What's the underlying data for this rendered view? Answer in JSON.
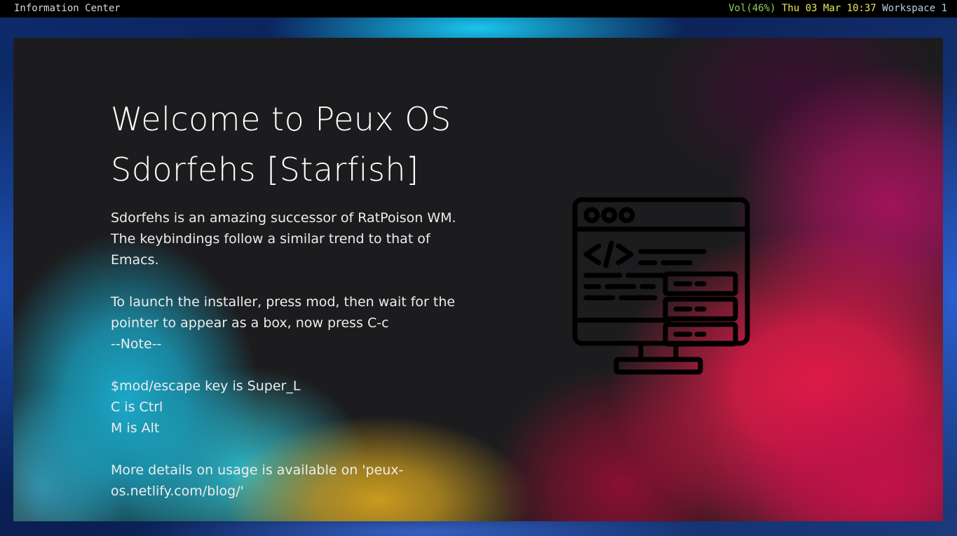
{
  "statusbar": {
    "window_title": "Information Center",
    "volume": "Vol(46%)",
    "clock": "Thu 03 Mar 10:37",
    "workspace": "Workspace 1"
  },
  "window": {
    "title_line1": "Welcome to Peux OS",
    "title_line2": "Sdorfehs [Starfish]",
    "paragraphs": [
      "Sdorfehs is an amazing successor of RatPoison WM. The keybindings follow a similar trend to that of Emacs.",
      "To launch the installer, press mod, then wait for the pointer to appear as a box, now press C-c",
      "--Note--",
      "$mod/escape key is Super_L",
      "C is Ctrl",
      "M is Alt",
      "More details on usage is available on 'peux-os.netlify.com/blog/'"
    ],
    "illustration_icon": "code-monitor-server-icon"
  },
  "colors": {
    "statusbar_bg": "#000000",
    "volume": "#8fd05a",
    "clock": "#e8e85a",
    "workspace": "#b8cfe8",
    "window_bg": "#1c1c1e",
    "text": "#f0f0f0"
  }
}
